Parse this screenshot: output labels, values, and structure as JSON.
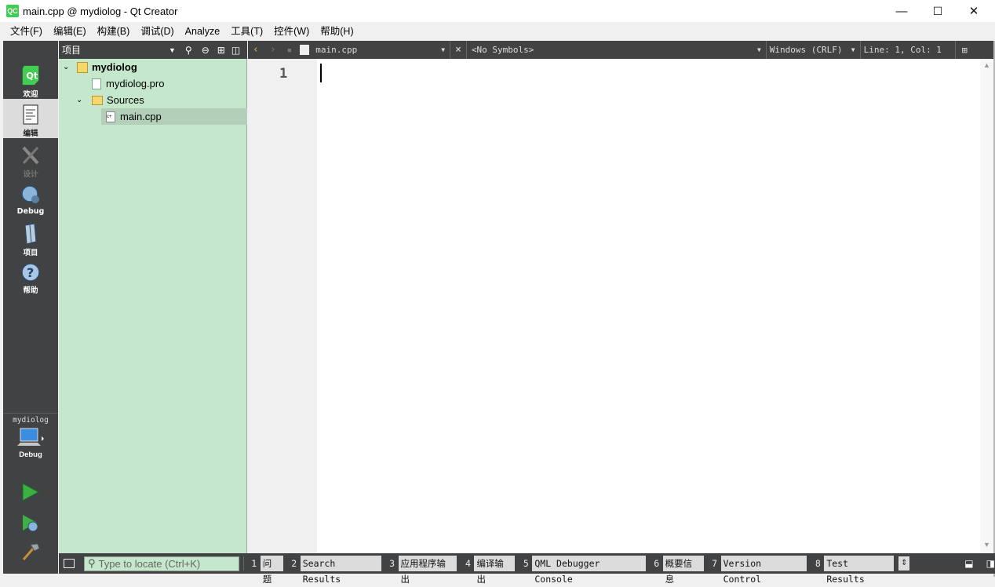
{
  "window": {
    "app_icon_text": "QC",
    "title": "main.cpp @ mydiolog - Qt Creator",
    "minimize": "—",
    "maximize": "☐",
    "close": "✕"
  },
  "menubar": {
    "items": [
      "文件(F)",
      "编辑(E)",
      "构建(B)",
      "调试(D)",
      "Analyze",
      "工具(T)",
      "控件(W)",
      "帮助(H)"
    ]
  },
  "modes": [
    {
      "label": "欢迎",
      "icon": "qt-logo-icon"
    },
    {
      "label": "编辑",
      "icon": "edit-document-icon"
    },
    {
      "label": "设计",
      "icon": "design-pencil-icon"
    },
    {
      "label": "Debug",
      "icon": "debug-bug-icon"
    },
    {
      "label": "项目",
      "icon": "project-wrench-icon"
    },
    {
      "label": "帮助",
      "icon": "help-question-icon"
    }
  ],
  "kit": {
    "project": "mydiolog",
    "build": "Debug"
  },
  "sidebar": {
    "view_label": "项目",
    "tree": [
      {
        "label": "mydiolog",
        "bold": true
      },
      {
        "label": "mydiolog.pro",
        "bold": false
      },
      {
        "label": "Sources",
        "bold": false
      },
      {
        "label": "main.cpp",
        "bold": false
      }
    ]
  },
  "editor": {
    "file": "main.cpp",
    "symbols": "<No Symbols>",
    "line_ending": "Windows (CRLF)",
    "position": "Line: 1, Col: 1",
    "line_numbers": [
      "1"
    ]
  },
  "bottom": {
    "locator_placeholder": "Type to locate (Ctrl+K)",
    "panes": [
      {
        "num": "1",
        "name": "问题"
      },
      {
        "num": "2",
        "name": "Search Results"
      },
      {
        "num": "3",
        "name": "应用程序输出"
      },
      {
        "num": "4",
        "name": "编译输出"
      },
      {
        "num": "5",
        "name": "QML Debugger Console"
      },
      {
        "num": "6",
        "name": "概要信息"
      },
      {
        "num": "7",
        "name": "Version Control"
      },
      {
        "num": "8",
        "name": "Test Results"
      }
    ]
  },
  "colors": {
    "dark_bar": "#404244",
    "tree_bg": "#c5e8cc",
    "qt_green": "#41cd52",
    "run_green": "#3cb043"
  }
}
